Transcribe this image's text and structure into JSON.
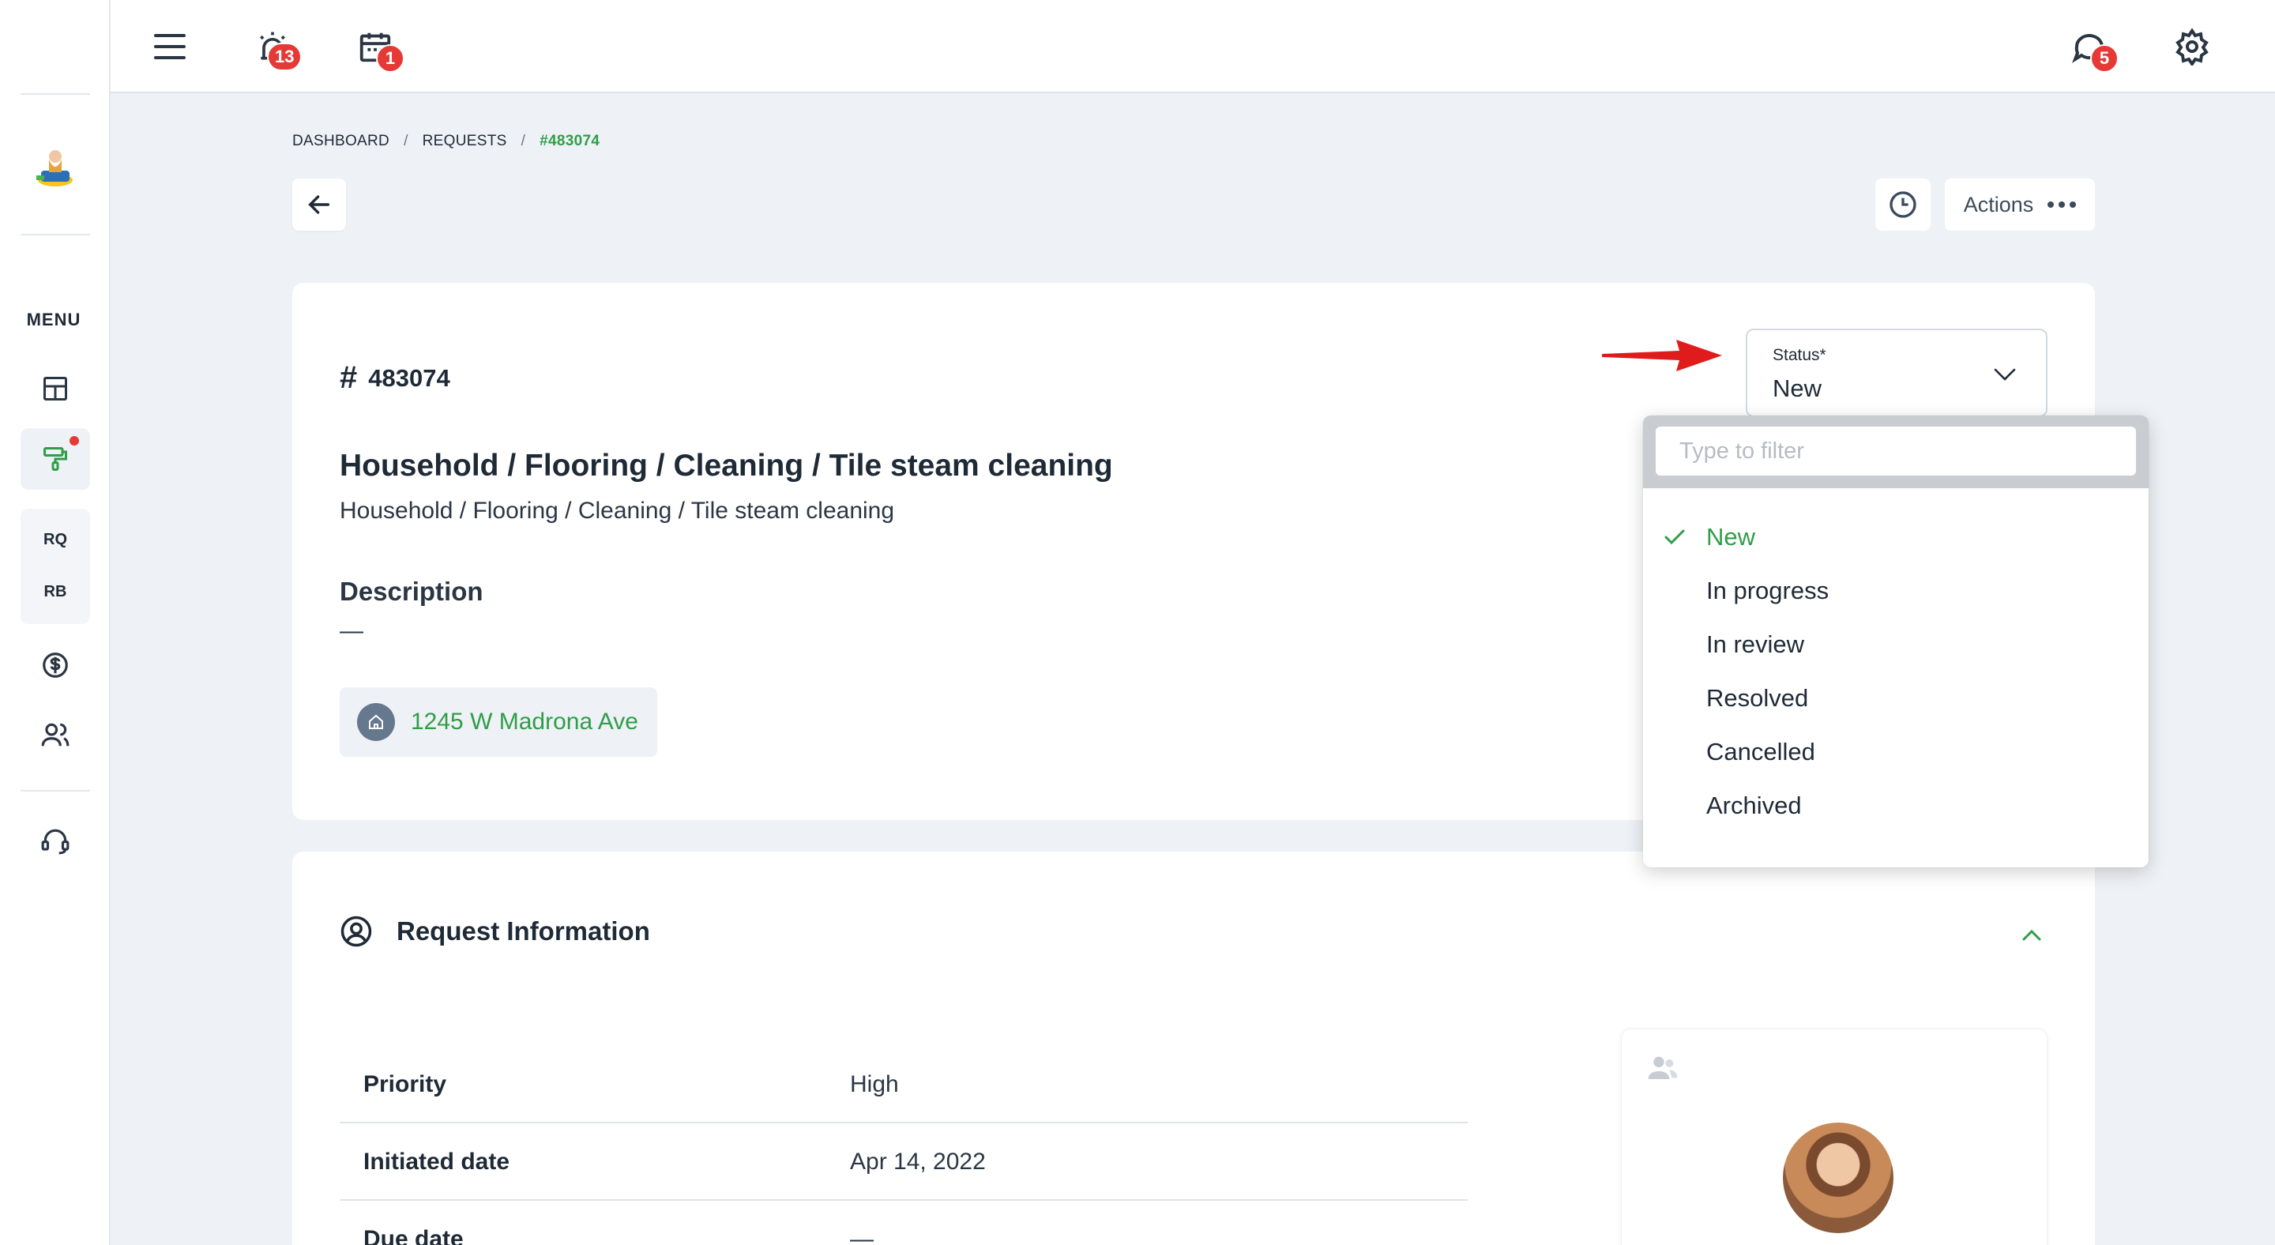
{
  "topbar": {
    "alerts_badge": "13",
    "calendar_badge": "1",
    "messages_badge": "5"
  },
  "sidebar": {
    "menu_label": "MENU",
    "abbr_items": [
      "RQ",
      "RB"
    ]
  },
  "breadcrumb": {
    "items": [
      "DASHBOARD",
      "REQUESTS",
      "#483074"
    ],
    "separator": "/"
  },
  "toolbar": {
    "actions_label": "Actions"
  },
  "request": {
    "id": "483074",
    "title": "Household / Flooring / Cleaning / Tile steam cleaning",
    "subtitle": "Household / Flooring / Cleaning / Tile steam cleaning",
    "description_label": "Description",
    "description_value": "—",
    "address": "1245 W Madrona Ave"
  },
  "status": {
    "label": "Status*",
    "value": "New",
    "filter_placeholder": "Type to filter",
    "options": [
      {
        "label": "New",
        "selected": true
      },
      {
        "label": "In progress",
        "selected": false
      },
      {
        "label": "In review",
        "selected": false
      },
      {
        "label": "Resolved",
        "selected": false
      },
      {
        "label": "Cancelled",
        "selected": false
      },
      {
        "label": "Archived",
        "selected": false
      }
    ]
  },
  "request_info": {
    "title": "Request Information",
    "rows": [
      {
        "key": "Priority",
        "value": "High"
      },
      {
        "key": "Initiated date",
        "value": "Apr 14, 2022"
      },
      {
        "key": "Due date",
        "value": "—"
      }
    ]
  },
  "colors": {
    "accent_green": "#2e9e48",
    "badge_red": "#e53935",
    "text_dark": "#1f2a37",
    "background": "#eef1f5"
  }
}
